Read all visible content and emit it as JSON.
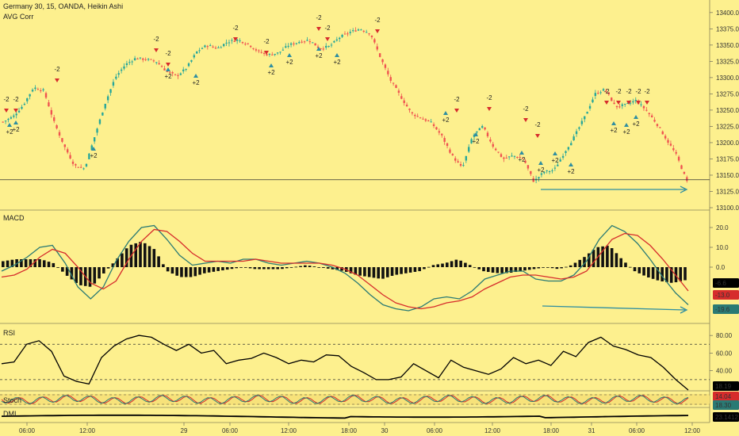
{
  "header": {
    "instrument": "Germany 30, 15, OANDA, Heikin Ashi",
    "indicator": "AVG Corr"
  },
  "panes": {
    "macd": "MACD",
    "rsi": "RSI",
    "stoch": "Stoch",
    "dmi": "DMI"
  },
  "price_axis": [
    "13400.0",
    "13375.0",
    "13350.0",
    "13325.0",
    "13300.0",
    "13275.0",
    "13250.0",
    "13225.0",
    "13200.0",
    "13175.0",
    "13150.0",
    "13125.0",
    "13100.0"
  ],
  "macd_axis": [
    "20.0",
    "10.0",
    "0.0"
  ],
  "rsi_axis": [
    "80.00",
    "60.00",
    "40.00"
  ],
  "time_axis": [
    "06:00",
    "12:00",
    "29",
    "06:00",
    "12:00",
    "18:00",
    "30",
    "06:00",
    "12:00",
    "18:00",
    "31",
    "06:00",
    "12:00"
  ],
  "badges": {
    "macd_hist": {
      "text": "-6.6",
      "color": "#000000"
    },
    "macd_signal": {
      "text": "-13.0",
      "color": "#d62c2c"
    },
    "macd_line": {
      "text": "-19.6",
      "color": "#2a7a74"
    },
    "rsi": {
      "text": "18.19",
      "color": "#000000"
    },
    "stoch_k": {
      "text": "14.04",
      "color": "#d62c2c"
    },
    "stoch_d": {
      "text": "18.30",
      "color": "#2a7a74"
    },
    "dmi": {
      "text": "23.1412",
      "color": "#000000"
    }
  },
  "signals": {
    "buy": "+2",
    "sell": "-2",
    "note": "S"
  },
  "chart_data": [
    {
      "type": "candlestick",
      "title": "Germany 30, 15, OANDA, Heikin Ashi",
      "ylim": [
        13100,
        13412
      ],
      "close_path": [
        13232,
        13240,
        13258,
        13285,
        13280,
        13232,
        13195,
        13165,
        13160,
        13210,
        13260,
        13300,
        13320,
        13330,
        13328,
        13325,
        13310,
        13302,
        13315,
        13340,
        13350,
        13345,
        13355,
        13358,
        13352,
        13340,
        13335,
        13338,
        13350,
        13355,
        13358,
        13345,
        13348,
        13362,
        13370,
        13375,
        13368,
        13330,
        13295,
        13270,
        13245,
        13238,
        13230,
        13210,
        13180,
        13160,
        13210,
        13225,
        13195,
        13175,
        13180,
        13175,
        13140,
        13155,
        13158,
        13185,
        13210,
        13240,
        13275,
        13282,
        13255,
        13258,
        13265,
        13250,
        13230,
        13205,
        13180,
        13140
      ],
      "candles": 255,
      "up_color": "#26a69a",
      "down_color": "#ef5350",
      "horizontal_level": 13143,
      "trendline": [
        13128,
        13128
      ]
    },
    {
      "type": "line",
      "title": "MACD",
      "ylim": [
        -26,
        26
      ],
      "series": [
        {
          "color": "#2a7a74",
          "values": [
            -2,
            1,
            5,
            10,
            11,
            2,
            -10,
            -16,
            -10,
            3,
            13,
            20,
            21,
            14,
            6,
            1,
            2,
            3,
            2,
            4,
            4,
            2,
            1,
            2,
            3,
            2,
            0,
            -3,
            -8,
            -14,
            -19,
            -21,
            -22,
            -20,
            -16,
            -15,
            -16,
            -12,
            -6,
            -4,
            -2,
            -2,
            -6,
            -7,
            -7,
            -4,
            3,
            14,
            21,
            18,
            12,
            4,
            -5,
            -13,
            -19
          ]
        },
        {
          "color": "#d62c2c",
          "values": [
            -5,
            -4,
            -1,
            5,
            9,
            7,
            0,
            -8,
            -11,
            -7,
            4,
            13,
            19,
            18,
            13,
            7,
            3,
            3,
            3,
            3,
            4,
            3,
            2,
            2,
            2,
            2,
            1,
            -1,
            -4,
            -9,
            -14,
            -18,
            -20,
            -21,
            -20,
            -18,
            -17,
            -15,
            -11,
            -8,
            -5,
            -4,
            -4,
            -5,
            -6,
            -5,
            -2,
            6,
            14,
            17,
            16,
            11,
            4,
            -4,
            -12
          ]
        }
      ],
      "histogram": [
        3,
        4,
        4,
        4,
        2,
        -4,
        -9,
        -10,
        -3,
        4,
        11,
        13,
        9,
        -2,
        -5,
        -5,
        -3,
        -2,
        -1,
        0,
        -1,
        -1,
        -1,
        0,
        1,
        0,
        -1,
        -2,
        -4,
        -5,
        -6,
        -4,
        -3,
        -2,
        1,
        2,
        4,
        1,
        -2,
        -3,
        -3,
        -2,
        -1,
        0,
        -1,
        1,
        5,
        10,
        11,
        4,
        -2,
        -5,
        -7,
        -8,
        -6.6
      ]
    },
    {
      "type": "line",
      "title": "RSI",
      "ylim": [
        20,
        90
      ],
      "series": [
        {
          "color": "#000000",
          "values": [
            48,
            50,
            70,
            74,
            62,
            34,
            28,
            25,
            55,
            68,
            76,
            80,
            78,
            70,
            63,
            70,
            60,
            63,
            48,
            52,
            54,
            60,
            55,
            48,
            52,
            50,
            58,
            57,
            45,
            38,
            30,
            30,
            33,
            48,
            40,
            32,
            52,
            44,
            40,
            36,
            42,
            55,
            48,
            52,
            46,
            62,
            56,
            72,
            78,
            68,
            64,
            58,
            55,
            44,
            30,
            18.19
          ]
        }
      ],
      "levels": [
        70,
        30
      ]
    },
    {
      "type": "line",
      "title": "Stoch",
      "series": [
        {
          "name": "%K",
          "color": "#d62c2c",
          "last": 14.04
        },
        {
          "name": "%D",
          "color": "#2a7a74",
          "last": 18.3
        }
      ]
    },
    {
      "type": "line",
      "title": "DMI",
      "series": [
        {
          "color": "#000000",
          "last": 23.1412
        }
      ]
    }
  ]
}
